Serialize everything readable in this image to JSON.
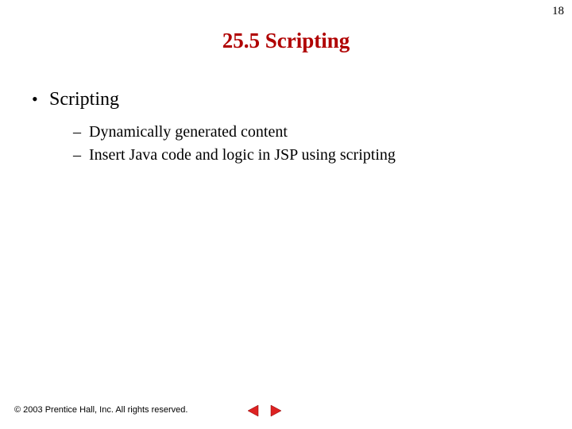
{
  "page_number": "18",
  "title": "25.5   Scripting",
  "bullets": {
    "main": "Scripting",
    "subs": [
      "Dynamically generated content",
      "Insert Java code and logic in JSP using scripting"
    ]
  },
  "footer": {
    "copyright": "© 2003 Prentice Hall, Inc. All rights reserved."
  },
  "nav": {
    "prev_icon": "prev-arrow-icon",
    "next_icon": "next-arrow-icon"
  },
  "colors": {
    "title": "#b00000",
    "arrow": "#d22"
  }
}
